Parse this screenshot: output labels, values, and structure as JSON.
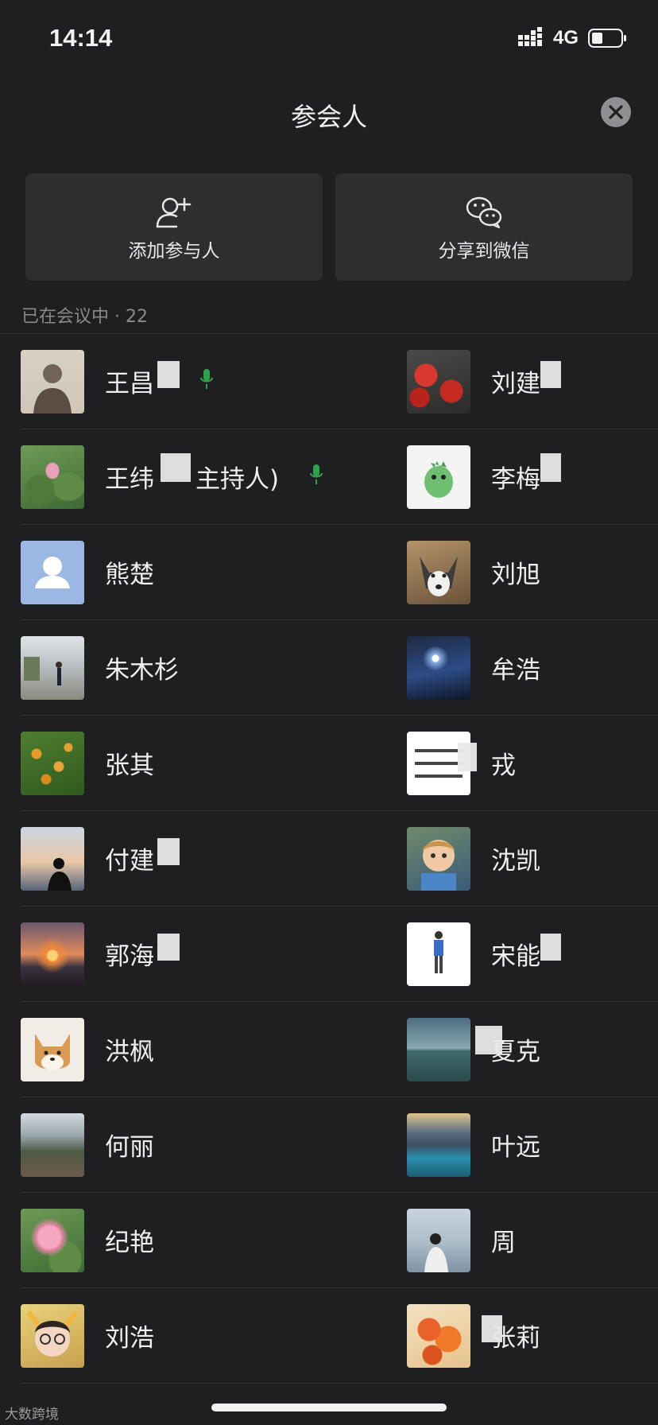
{
  "status": {
    "time": "14:14",
    "network": "4G"
  },
  "header": {
    "title": "参会人"
  },
  "actions": {
    "add_label": "添加参与人",
    "share_label": "分享到微信"
  },
  "section": {
    "label": "已在会议中 · 22"
  },
  "participants": {
    "left": [
      "王昌",
      "王纬",
      "熊楚",
      "朱木杉",
      "张其",
      "付建",
      "郭海",
      "洪枫",
      "何丽",
      "纪艳",
      "刘浩"
    ],
    "right": [
      "刘建",
      "李梅",
      "刘旭",
      "牟浩",
      "戎",
      "沈凯",
      "宋能",
      "夏克",
      "叶远",
      "周",
      "张莉"
    ],
    "host_suffix": "主持人)"
  },
  "watermark": "大数跨境"
}
